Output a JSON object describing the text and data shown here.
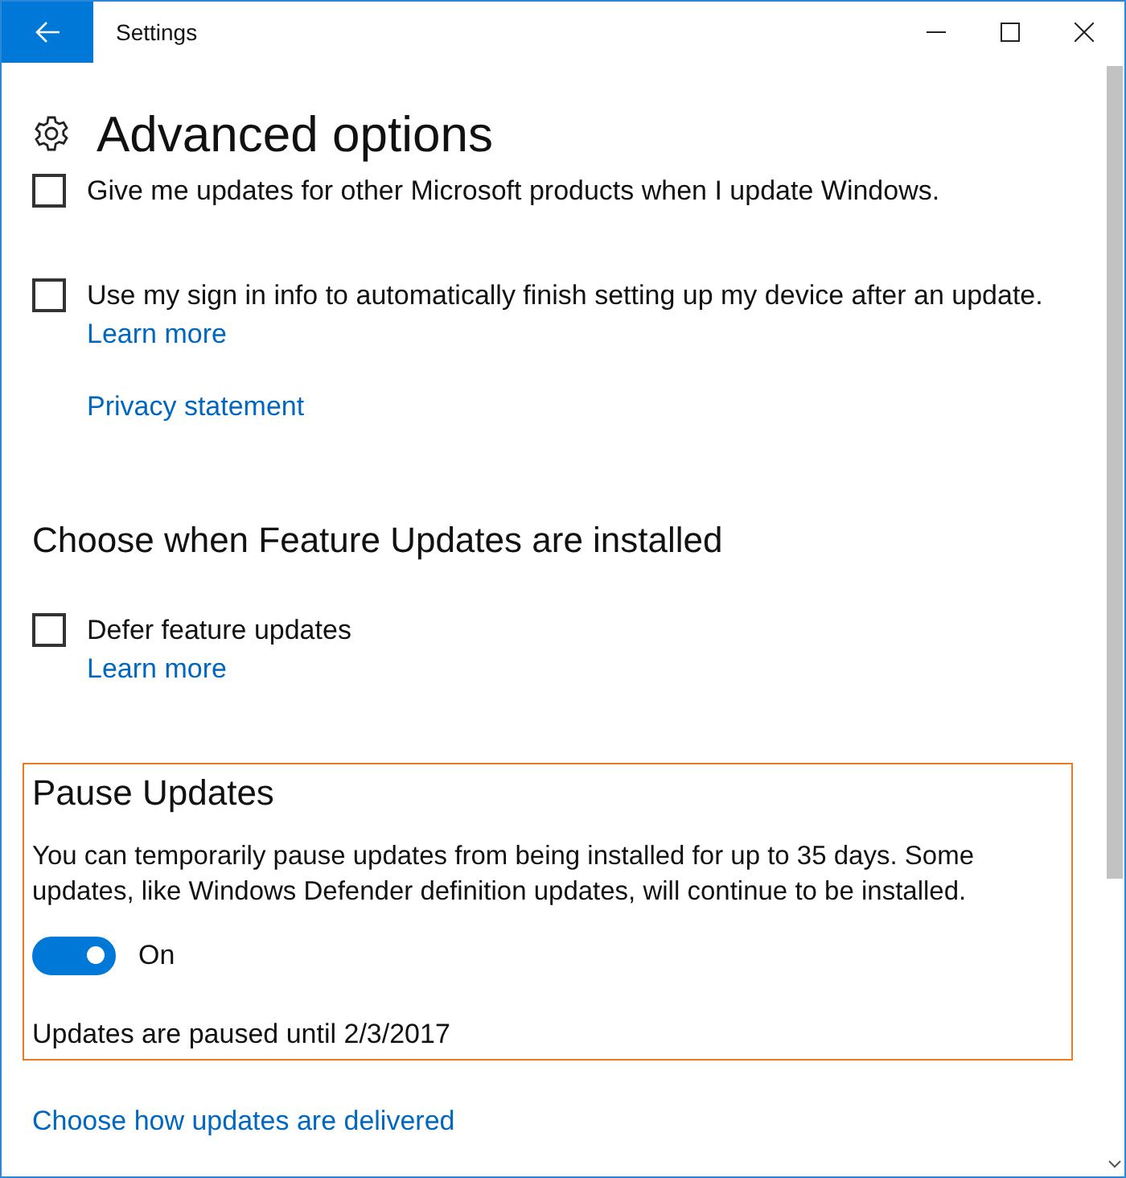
{
  "window": {
    "title": "Settings"
  },
  "page": {
    "title": "Advanced options"
  },
  "options": [
    {
      "label": "Give me updates for other Microsoft products when I update Windows.",
      "checked": false
    },
    {
      "label": "Use my sign in info to automatically finish setting up my device after an update.",
      "checked": false,
      "links": [
        "Learn more"
      ]
    }
  ],
  "privacy_link": "Privacy statement",
  "feature_updates": {
    "heading": "Choose when Feature Updates are installed",
    "options": [
      {
        "label": "Defer feature updates",
        "checked": false,
        "links": [
          "Learn more"
        ]
      }
    ]
  },
  "pause_updates": {
    "heading": "Pause Updates",
    "description": "You can temporarily pause updates from being installed for up to 35 days. Some updates, like Windows Defender definition updates, will continue to be installed.",
    "toggle": {
      "on": true,
      "label": "On"
    },
    "status": "Updates are paused until 2/3/2017"
  },
  "delivery_link": "Choose how updates are delivered"
}
